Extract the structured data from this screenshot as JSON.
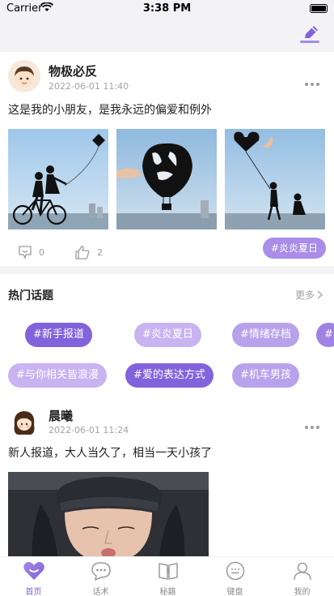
{
  "status_bar": {
    "carrier": "Carrier",
    "time": "3:38 PM"
  },
  "post1": {
    "username": "物极必反",
    "timestamp": "2022-06-01 11:40",
    "content": "这是我的小朋友，是我永远的偏爱和例外",
    "comment_count": "0",
    "like_count": "2",
    "topic": "#炎炎夏日"
  },
  "topics": {
    "title": "热门话题",
    "more_label": "更多",
    "chips": [
      "#新手报道",
      "#炎炎夏日",
      "#情绪存档",
      "#",
      "#与你相关皆浪漫",
      "#爱的表达方式",
      "#机车男孩"
    ]
  },
  "post2": {
    "username": "晨曦",
    "timestamp": "2022-06-01 11:24",
    "content": "新人报道，大人当久了，相当一天小孩了"
  },
  "tabs": [
    {
      "label": "首页",
      "icon": "heart-icon",
      "active": true
    },
    {
      "label": "话术",
      "icon": "chat-icon",
      "active": false
    },
    {
      "label": "秘籍",
      "icon": "book-icon",
      "active": false
    },
    {
      "label": "键盘",
      "icon": "keyboard-icon",
      "active": false
    },
    {
      "label": "我的",
      "icon": "profile-icon",
      "active": false
    }
  ],
  "colors": {
    "accent": "#7f5fd8",
    "chip_dark": "#8363dc",
    "chip_light": "#c9b3f0"
  }
}
